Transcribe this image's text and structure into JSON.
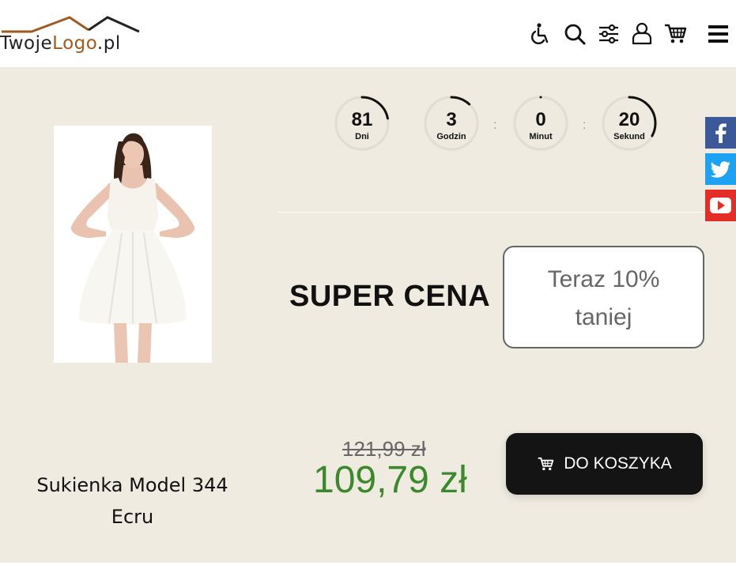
{
  "header": {
    "logo": {
      "part1": "Twoje",
      "part2": "Logo",
      "part3": ".pl"
    },
    "icons": [
      "wheelchair-icon",
      "search-icon",
      "sliders-icon",
      "user-icon",
      "cart-icon",
      "menu-icon"
    ]
  },
  "countdown": [
    {
      "value": "81",
      "label": "Dni",
      "progress": 0.22
    },
    {
      "value": "3",
      "label": "Godzin",
      "progress": 0.12
    },
    {
      "value": "0",
      "label": "Minut",
      "progress": 0.0
    },
    {
      "value": "20",
      "label": "Sekund",
      "progress": 0.33
    }
  ],
  "separators": [
    ":",
    ":"
  ],
  "social": [
    {
      "name": "facebook",
      "color": "#3b5998"
    },
    {
      "name": "twitter",
      "color": "#1da1f2"
    },
    {
      "name": "youtube",
      "color": "#e52d27"
    }
  ],
  "promo": {
    "headline": "SUPER CENA",
    "line1": "Teraz 10%",
    "line2": "taniej"
  },
  "price": {
    "old": "121,99 zł",
    "new": "109,79 zł",
    "new_color": "#3a8a2c"
  },
  "cart_button": {
    "label": "DO KOSZYKA"
  },
  "product": {
    "name_line1": "Sukienka Model 344",
    "name_line2": "Ecru"
  }
}
